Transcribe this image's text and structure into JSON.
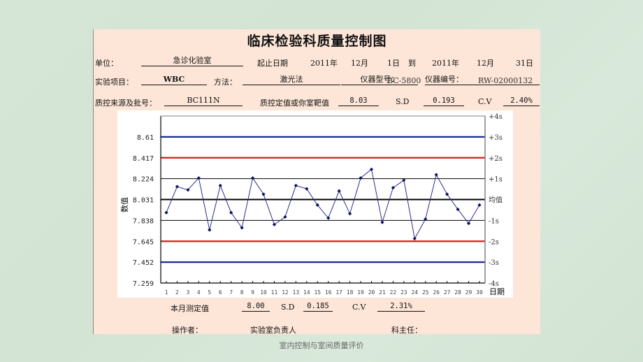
{
  "title": "临床检验科质量控制图",
  "header": {
    "unit_label": "单位：",
    "unit_value": "急诊化验室",
    "period_label": "起止日期",
    "start_year": "2011年",
    "start_month": "12月",
    "start_day": "1日",
    "to_label": "到",
    "end_year": "2011年",
    "end_month": "12月",
    "end_day": "31日",
    "item_label": "实验项目：",
    "item_value": "WBC",
    "method_label": "方法：",
    "method_value": "激光法",
    "model_label": "仪器型号：",
    "model_value": "BC-5800",
    "serial_label": "仪器编号：",
    "serial_value": "RW-02000132",
    "source_label": "质控来源及批号：",
    "source_value": "BC111N",
    "target_label": "质控定值或你室靶值",
    "target_value": "8.03",
    "sd_label": "S.D",
    "sd_value": "0.193",
    "cv_label": "C.V",
    "cv_value": "2.40%"
  },
  "summary": {
    "month_label": "本月测定值",
    "month_value": "8.00",
    "sd_label": "S.D",
    "sd_value": "0.185",
    "cv_label": "C.V",
    "cv_value": "2.31%"
  },
  "signatures": {
    "operator_label": "操作者：",
    "lab_head_label": "实验室负责人",
    "dept_head_label": "科主任："
  },
  "footer_caption": "室内控制与室间质量评价",
  "colors": {
    "sd3": "#1a2a9a",
    "sd2": "#e01818",
    "sd1": "#000000",
    "mean": "#000000",
    "series": "#2a2f8a",
    "marker": "#0a1060",
    "sheet_bg": "#fde6d8",
    "page_bg": "#d6e6d6"
  },
  "chart_data": {
    "type": "line",
    "title": "",
    "xlabel": "日期",
    "ylabel": "数值",
    "x": [
      1,
      2,
      3,
      4,
      5,
      6,
      7,
      8,
      9,
      10,
      11,
      12,
      13,
      14,
      15,
      16,
      17,
      18,
      19,
      20,
      21,
      22,
      23,
      24,
      25,
      26,
      27,
      28,
      29,
      30
    ],
    "series": [
      {
        "name": "WBC",
        "values": [
          7.91,
          8.15,
          8.12,
          8.23,
          7.75,
          8.16,
          7.91,
          7.77,
          8.23,
          8.08,
          7.8,
          7.87,
          8.16,
          8.13,
          7.98,
          7.86,
          8.11,
          7.9,
          8.23,
          8.31,
          7.82,
          8.14,
          8.21,
          7.67,
          7.85,
          8.26,
          8.08,
          7.94,
          7.81,
          7.98
        ]
      }
    ],
    "mean": 8.031,
    "sd": 0.193,
    "ylim": [
      7.259,
      8.803
    ],
    "y_ticks": [
      "8.61",
      "8.417",
      "8.224",
      "8.031",
      "7.838",
      "7.645",
      "7.452",
      "7.259"
    ],
    "y_tick_values": [
      8.61,
      8.417,
      8.224,
      8.031,
      7.838,
      7.645,
      7.452,
      7.259
    ],
    "right_labels": [
      "+4s",
      "+3s",
      "+2s",
      "+1s",
      "均值",
      "-1s",
      "-2s",
      "-3s",
      "-4s"
    ],
    "control_lines": [
      {
        "name": "+3s",
        "value": 8.61,
        "color": "sd3"
      },
      {
        "name": "+2s",
        "value": 8.417,
        "color": "sd2"
      },
      {
        "name": "+1s",
        "value": 8.224,
        "color": "sd1"
      },
      {
        "name": "mean",
        "value": 8.031,
        "color": "mean"
      },
      {
        "name": "-1s",
        "value": 7.838,
        "color": "sd1"
      },
      {
        "name": "-2s",
        "value": 7.645,
        "color": "sd2"
      },
      {
        "name": "-3s",
        "value": 7.452,
        "color": "sd3"
      }
    ],
    "grid": false,
    "legend": "none"
  }
}
